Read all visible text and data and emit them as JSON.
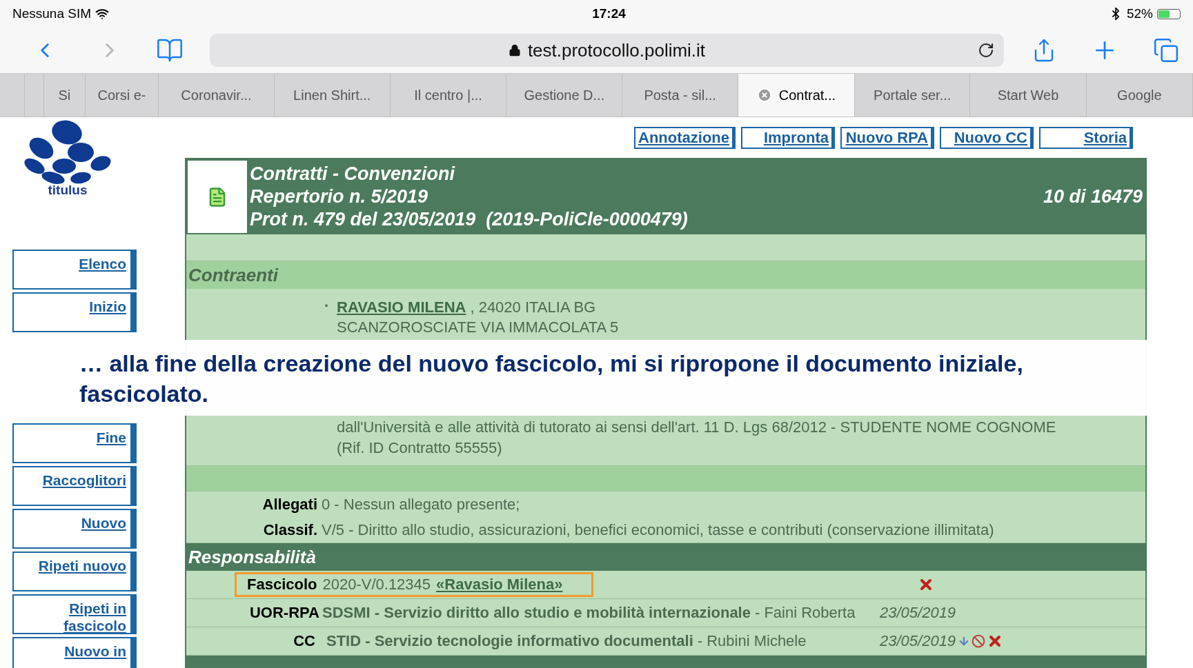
{
  "status_bar": {
    "carrier": "Nessuna SIM",
    "time": "17:24",
    "battery": "52%"
  },
  "address_bar": {
    "url": "test.protocollo.polimi.it"
  },
  "tabs": [
    {
      "label": "Si",
      "selected": false
    },
    {
      "label": "Corsi e-",
      "selected": false
    },
    {
      "label": "Coronavir...",
      "selected": false
    },
    {
      "label": "Linen Shirt...",
      "selected": false
    },
    {
      "label": "Il centro |...",
      "selected": false
    },
    {
      "label": "Gestione D...",
      "selected": false
    },
    {
      "label": "Posta - sil...",
      "selected": false
    },
    {
      "label": "Contrat...",
      "selected": true
    },
    {
      "label": "Portale ser...",
      "selected": false
    },
    {
      "label": "Start Web",
      "selected": false
    },
    {
      "label": "Google",
      "selected": false
    }
  ],
  "logo": {
    "text": "titulus"
  },
  "sidebar": {
    "upper_items": [
      "Elenco",
      "Inizio"
    ],
    "lower_items": [
      "Fine",
      "Raccoglitori",
      "Nuovo",
      "Ripeti nuovo",
      "Ripeti in fascicolo",
      "Nuovo in"
    ]
  },
  "actions": [
    "Annotazione",
    "Impronta",
    "Nuovo RPA",
    "Nuovo CC",
    "Storia"
  ],
  "header": {
    "lines": [
      "Contratti - Convenzioni",
      "Repertorio n. 5/2019",
      "Prot n. 479 del 23/05/2019  (2019-PoliCle-0000479)"
    ],
    "counter": "10 di 16479"
  },
  "contraenti": {
    "title": "Contraenti",
    "bullet": "·",
    "name": "RAVASIO MILENA",
    "address": ", 24020 ITALIA BG",
    "address_line_2": "SCANZOROSCIATE VIA IMMACOLATA 5"
  },
  "oggetto_lines": [
    "dall'Università e alle attività di tutorato ai sensi dell'art. 11 D. Lgs 68/2012 - STUDENTE NOME COGNOME",
    "(Rif. ID Contratto 55555)"
  ],
  "fields": [
    {
      "label": "Allegati",
      "value": "0 - Nessun allegato presente;"
    },
    {
      "label": "Classif.",
      "value": "V/5 - Diritto allo studio, assicurazioni, benefici economici, tasse e contributi (conservazione illimitata)"
    }
  ],
  "responsabilita": {
    "title": "Responsabilità",
    "rows": [
      {
        "kind": "fascicolo",
        "label": "Fascicolo",
        "code": "2020-V/0.12345",
        "link": "«Ravasio Milena»",
        "highlighted": true,
        "movable": false,
        "blockable": false,
        "deletable": true
      },
      {
        "kind": "person",
        "label": "UOR-RPA",
        "office": "SDSMI - Servizio diritto allo studio e mobilità internazionale",
        "person": "- Faini Roberta",
        "date": "23/05/2019",
        "movable": false,
        "blockable": false,
        "deletable": false
      },
      {
        "kind": "person",
        "label": "CC",
        "office": "STID - Servizio tecnologie informativo documentali",
        "person": "- Rubini Michele",
        "date": "23/05/2019",
        "movable": true,
        "blockable": true,
        "deletable": true
      }
    ]
  },
  "caption": "… alla fine della creazione del nuovo fascicolo, mi si ripropone il documento iniziale, fascicolato."
}
